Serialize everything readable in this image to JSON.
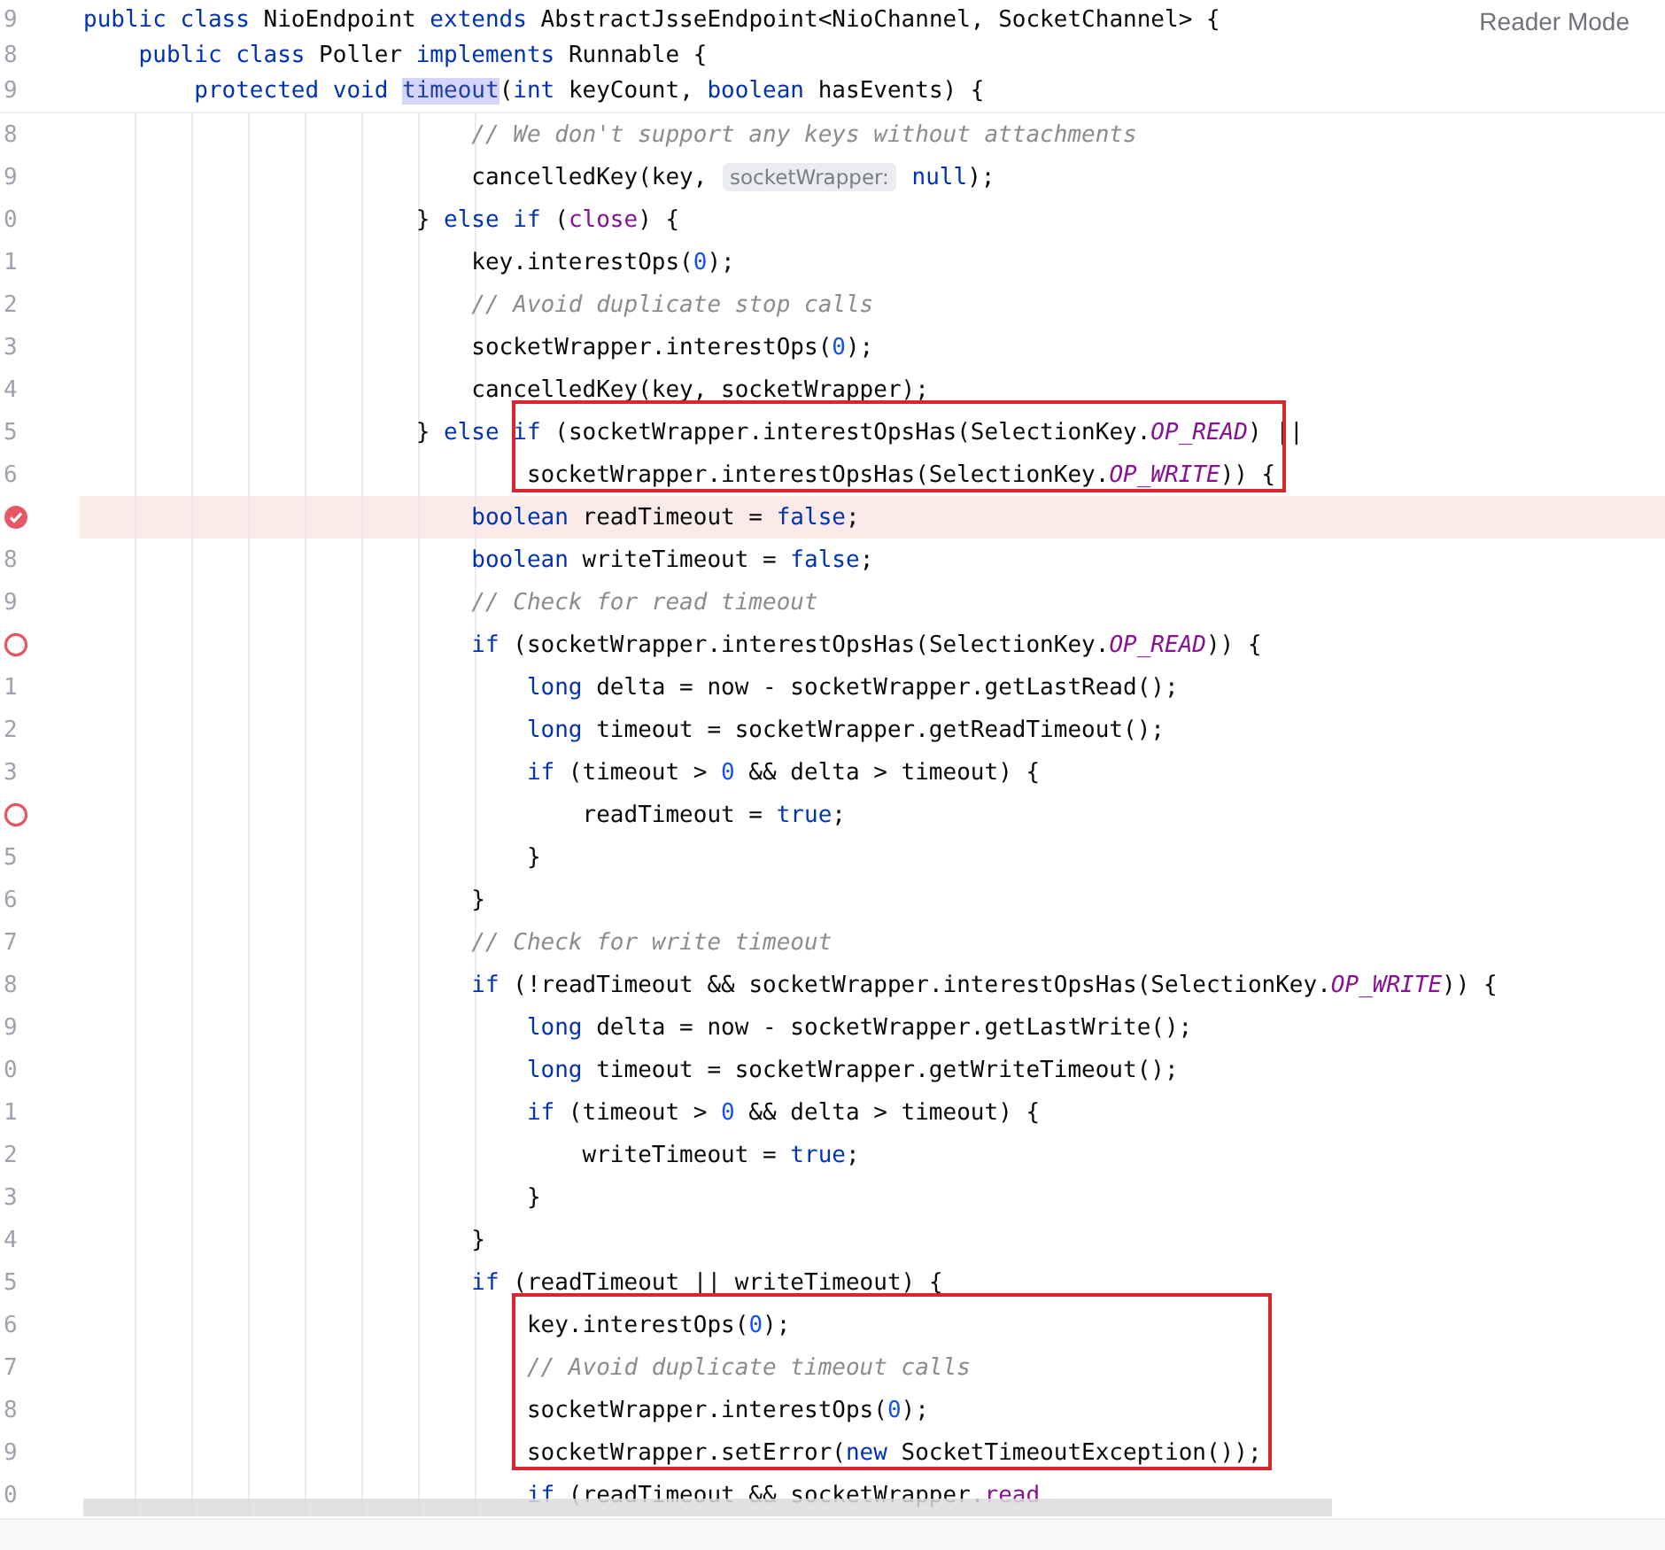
{
  "reader_mode": {
    "label": "Reader Mode"
  },
  "sticky_header": [
    {
      "number": "9",
      "tokens": [
        {
          "kind": "keyword",
          "text": "public class"
        },
        {
          "kind": "plain",
          "text": " NioEndpoint "
        },
        {
          "kind": "keyword",
          "text": "extends"
        },
        {
          "kind": "plain",
          "text": " AbstractJsseEndpoint<NioChannel, SocketChannel> {"
        }
      ]
    },
    {
      "number": "8",
      "tokens": [
        {
          "kind": "keyword",
          "text": "    public class"
        },
        {
          "kind": "plain",
          "text": " Poller "
        },
        {
          "kind": "keyword",
          "text": "implements"
        },
        {
          "kind": "plain",
          "text": " Runnable {"
        }
      ]
    },
    {
      "number": "9",
      "tokens": [
        {
          "kind": "keyword",
          "text": "        protected void "
        },
        {
          "kind": "usage",
          "text": "timeout"
        },
        {
          "kind": "plain",
          "text": "("
        },
        {
          "kind": "keyword",
          "text": "int"
        },
        {
          "kind": "plain",
          "text": " keyCount, "
        },
        {
          "kind": "keyword",
          "text": "boolean"
        },
        {
          "kind": "plain",
          "text": " hasEvents) {"
        }
      ]
    }
  ],
  "lines": [
    {
      "number": "8",
      "highlighted": false,
      "outlined": false,
      "tokens": [
        {
          "kind": "comment",
          "text": "                            // We don't support any keys without attachments"
        }
      ]
    },
    {
      "number": "9",
      "highlighted": false,
      "outlined": false,
      "tokens": [
        {
          "kind": "plain",
          "text": "                            cancelledKey(key, "
        },
        {
          "kind": "hint",
          "text": "socketWrapper:"
        },
        {
          "kind": "keyword",
          "text": " null"
        },
        {
          "kind": "plain",
          "text": ");"
        }
      ]
    },
    {
      "number": "0",
      "highlighted": false,
      "outlined": false,
      "tokens": [
        {
          "kind": "plain",
          "text": "                        } "
        },
        {
          "kind": "keyword",
          "text": "else if"
        },
        {
          "kind": "plain",
          "text": " ("
        },
        {
          "kind": "field",
          "text": "close"
        },
        {
          "kind": "plain",
          "text": ") {"
        }
      ]
    },
    {
      "number": "1",
      "highlighted": false,
      "outlined": false,
      "tokens": [
        {
          "kind": "plain",
          "text": "                            key.interestOps("
        },
        {
          "kind": "number",
          "text": "0"
        },
        {
          "kind": "plain",
          "text": ");"
        }
      ]
    },
    {
      "number": "2",
      "highlighted": false,
      "outlined": false,
      "tokens": [
        {
          "kind": "comment",
          "text": "                            // Avoid duplicate stop calls"
        }
      ]
    },
    {
      "number": "3",
      "highlighted": false,
      "outlined": false,
      "tokens": [
        {
          "kind": "plain",
          "text": "                            socketWrapper.interestOps("
        },
        {
          "kind": "number",
          "text": "0"
        },
        {
          "kind": "plain",
          "text": ");"
        }
      ]
    },
    {
      "number": "4",
      "highlighted": false,
      "outlined": false,
      "tokens": [
        {
          "kind": "plain",
          "text": "                            cancelledKey(key, socketWrapper);"
        }
      ]
    },
    {
      "number": "5",
      "highlighted": false,
      "outlined": true,
      "tokens": [
        {
          "kind": "plain",
          "text": "                        } "
        },
        {
          "kind": "keyword",
          "text": "else if"
        },
        {
          "kind": "plain",
          "text": " (socketWrapper.interestOpsHas(SelectionKey."
        },
        {
          "kind": "constant",
          "text": "OP_READ"
        },
        {
          "kind": "plain",
          "text": ") ||"
        }
      ]
    },
    {
      "number": "6",
      "highlighted": false,
      "outlined": true,
      "tokens": [
        {
          "kind": "plain",
          "text": "                                socketWrapper.interestOpsHas(SelectionKey."
        },
        {
          "kind": "constant",
          "text": "OP_WRITE"
        },
        {
          "kind": "plain",
          "text": ")) {"
        }
      ]
    },
    {
      "breakpoint": {
        "kind": "verified"
      },
      "highlighted": true,
      "outlined": false,
      "tokens": [
        {
          "kind": "keyword",
          "text": "                            boolean"
        },
        {
          "kind": "plain",
          "text": " readTimeout = "
        },
        {
          "kind": "keyword",
          "text": "false"
        },
        {
          "kind": "plain",
          "text": ";"
        }
      ]
    },
    {
      "number": "8",
      "highlighted": false,
      "outlined": false,
      "tokens": [
        {
          "kind": "keyword",
          "text": "                            boolean"
        },
        {
          "kind": "plain",
          "text": " writeTimeout = "
        },
        {
          "kind": "keyword",
          "text": "false"
        },
        {
          "kind": "plain",
          "text": ";"
        }
      ]
    },
    {
      "number": "9",
      "highlighted": false,
      "outlined": false,
      "tokens": [
        {
          "kind": "comment",
          "text": "                            // Check for read timeout"
        }
      ]
    },
    {
      "breakpoint": {
        "kind": "unverified"
      },
      "highlighted": false,
      "outlined": false,
      "tokens": [
        {
          "kind": "keyword",
          "text": "                            if"
        },
        {
          "kind": "plain",
          "text": " (socketWrapper.interestOpsHas(SelectionKey."
        },
        {
          "kind": "constant",
          "text": "OP_READ"
        },
        {
          "kind": "plain",
          "text": ")) {"
        }
      ]
    },
    {
      "number": "1",
      "highlighted": false,
      "outlined": false,
      "tokens": [
        {
          "kind": "keyword",
          "text": "                                long"
        },
        {
          "kind": "plain",
          "text": " delta = now - socketWrapper.getLastRead();"
        }
      ]
    },
    {
      "number": "2",
      "highlighted": false,
      "outlined": false,
      "tokens": [
        {
          "kind": "keyword",
          "text": "                                long"
        },
        {
          "kind": "plain",
          "text": " timeout = socketWrapper.getReadTimeout();"
        }
      ]
    },
    {
      "number": "3",
      "highlighted": false,
      "outlined": false,
      "tokens": [
        {
          "kind": "keyword",
          "text": "                                if"
        },
        {
          "kind": "plain",
          "text": " (timeout > "
        },
        {
          "kind": "number",
          "text": "0"
        },
        {
          "kind": "plain",
          "text": " && delta > timeout) {"
        }
      ]
    },
    {
      "breakpoint": {
        "kind": "unverified"
      },
      "highlighted": false,
      "outlined": false,
      "tokens": [
        {
          "kind": "plain",
          "text": "                                    readTimeout = "
        },
        {
          "kind": "keyword",
          "text": "true"
        },
        {
          "kind": "plain",
          "text": ";"
        }
      ]
    },
    {
      "number": "5",
      "highlighted": false,
      "outlined": false,
      "tokens": [
        {
          "kind": "plain",
          "text": "                                }"
        }
      ]
    },
    {
      "number": "6",
      "highlighted": false,
      "outlined": false,
      "tokens": [
        {
          "kind": "plain",
          "text": "                            }"
        }
      ]
    },
    {
      "number": "7",
      "highlighted": false,
      "outlined": false,
      "tokens": [
        {
          "kind": "comment",
          "text": "                            // Check for write timeout"
        }
      ]
    },
    {
      "number": "8",
      "highlighted": false,
      "outlined": false,
      "tokens": [
        {
          "kind": "keyword",
          "text": "                            if"
        },
        {
          "kind": "plain",
          "text": " (!readTimeout && socketWrapper.interestOpsHas(SelectionKey."
        },
        {
          "kind": "constant",
          "text": "OP_WRITE"
        },
        {
          "kind": "plain",
          "text": ")) {"
        }
      ]
    },
    {
      "number": "9",
      "highlighted": false,
      "outlined": false,
      "tokens": [
        {
          "kind": "keyword",
          "text": "                                long"
        },
        {
          "kind": "plain",
          "text": " delta = now - socketWrapper.getLastWrite();"
        }
      ]
    },
    {
      "number": "0",
      "highlighted": false,
      "outlined": false,
      "tokens": [
        {
          "kind": "keyword",
          "text": "                                long"
        },
        {
          "kind": "plain",
          "text": " timeout = socketWrapper.getWriteTimeout();"
        }
      ]
    },
    {
      "number": "1",
      "highlighted": false,
      "outlined": false,
      "tokens": [
        {
          "kind": "keyword",
          "text": "                                if"
        },
        {
          "kind": "plain",
          "text": " (timeout > "
        },
        {
          "kind": "number",
          "text": "0"
        },
        {
          "kind": "plain",
          "text": " && delta > timeout) {"
        }
      ]
    },
    {
      "number": "2",
      "highlighted": false,
      "outlined": false,
      "tokens": [
        {
          "kind": "plain",
          "text": "                                    writeTimeout = "
        },
        {
          "kind": "keyword",
          "text": "true"
        },
        {
          "kind": "plain",
          "text": ";"
        }
      ]
    },
    {
      "number": "3",
      "highlighted": false,
      "outlined": false,
      "tokens": [
        {
          "kind": "plain",
          "text": "                                }"
        }
      ]
    },
    {
      "number": "4",
      "highlighted": false,
      "outlined": false,
      "tokens": [
        {
          "kind": "plain",
          "text": "                            }"
        }
      ]
    },
    {
      "number": "5",
      "highlighted": false,
      "outlined": false,
      "tokens": [
        {
          "kind": "keyword",
          "text": "                            if"
        },
        {
          "kind": "plain",
          "text": " (readTimeout || writeTimeout) {"
        }
      ]
    },
    {
      "number": "6",
      "highlighted": false,
      "outlined": true,
      "tokens": [
        {
          "kind": "plain",
          "text": "                                key.interestOps("
        },
        {
          "kind": "number",
          "text": "0"
        },
        {
          "kind": "plain",
          "text": ");"
        }
      ]
    },
    {
      "number": "7",
      "highlighted": false,
      "outlined": true,
      "tokens": [
        {
          "kind": "comment",
          "text": "                                // Avoid duplicate timeout calls"
        }
      ]
    },
    {
      "number": "8",
      "highlighted": false,
      "outlined": true,
      "tokens": [
        {
          "kind": "plain",
          "text": "                                socketWrapper.interestOps("
        },
        {
          "kind": "number",
          "text": "0"
        },
        {
          "kind": "plain",
          "text": ");"
        }
      ]
    },
    {
      "number": "9",
      "highlighted": false,
      "outlined": true,
      "tokens": [
        {
          "kind": "plain",
          "text": "                                socketWrapper.setError("
        },
        {
          "kind": "keyword",
          "text": "new"
        },
        {
          "kind": "plain",
          "text": " SocketTimeoutException());"
        }
      ]
    },
    {
      "number": "0",
      "highlighted": false,
      "outlined": false,
      "tokens": [
        {
          "kind": "keyword",
          "text": "                                if"
        },
        {
          "kind": "plain",
          "text": " (readTimeout && socketWrapper."
        },
        {
          "kind": "field",
          "text": "read"
        }
      ]
    }
  ]
}
